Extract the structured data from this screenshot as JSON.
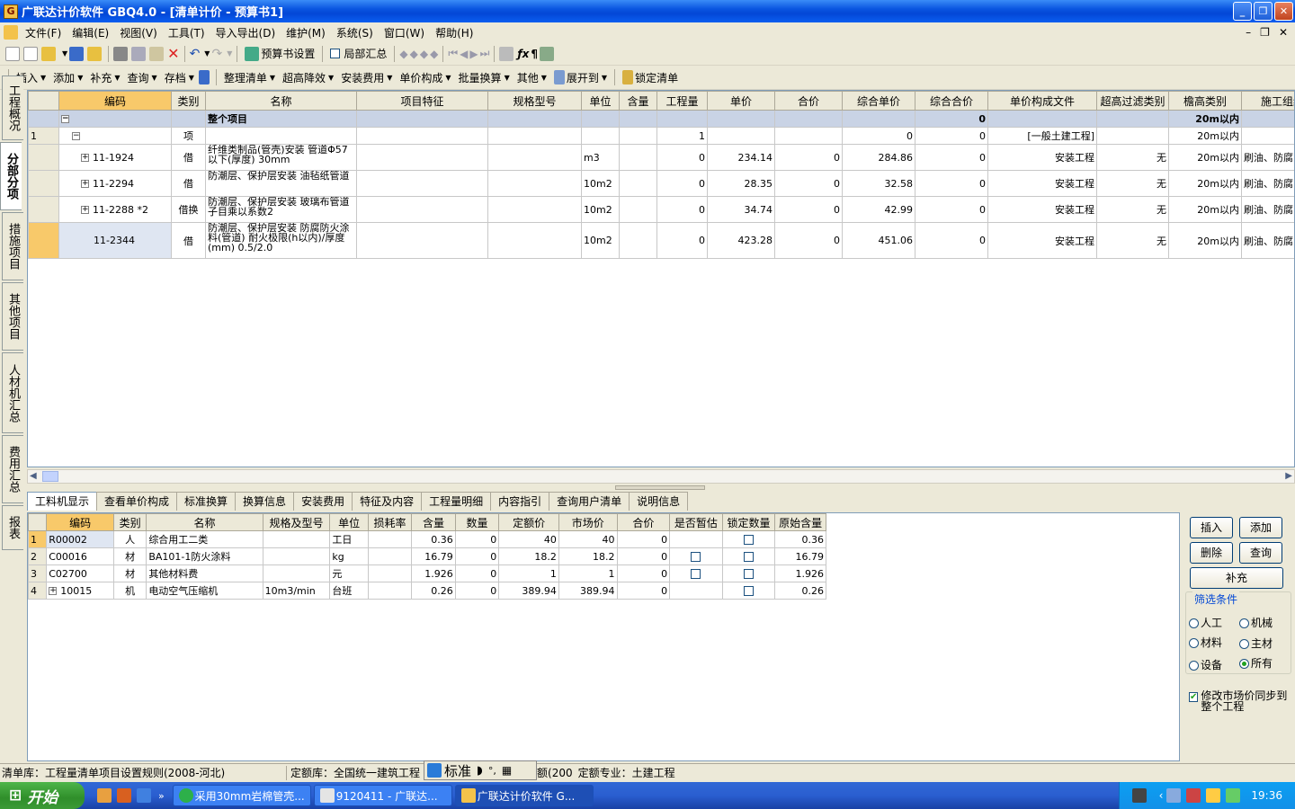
{
  "title": "广联达计价软件 GBQ4.0 - [清单计价 - 预算书1]",
  "menu": [
    "文件(F)",
    "编辑(E)",
    "视图(V)",
    "工具(T)",
    "导入导出(D)",
    "维护(M)",
    "系统(S)",
    "窗口(W)",
    "帮助(H)"
  ],
  "toolbar1": {
    "budget_settings": "预算书设置",
    "partial_summary": "局部汇总"
  },
  "toolbar2": [
    "插入",
    "添加",
    "补充",
    "查询",
    "存档",
    "整理清单",
    "超高降效",
    "安装费用",
    "单价构成",
    "批量换算",
    "其他",
    "展开到",
    "锁定清单"
  ],
  "sidetabs": [
    "工程概况",
    "分部分项",
    "措施项目",
    "其他项目",
    "人材机汇总",
    "费用汇总",
    "报表"
  ],
  "top_headers": [
    "编码",
    "类别",
    "名称",
    "项目特征",
    "规格型号",
    "单位",
    "含量",
    "工程量",
    "单价",
    "合价",
    "综合单价",
    "综合合价",
    "单价构成文件",
    "超高过滤类别",
    "檐高类别",
    "施工组织"
  ],
  "group_row": {
    "name": "整个项目",
    "total": "0",
    "height": "20m以内"
  },
  "top_rows": [
    {
      "rn": "1",
      "code": "",
      "cat": "项",
      "name": "",
      "unit": "",
      "qty": "1",
      "price": "",
      "total": "",
      "comp_price": "0",
      "comp_total": "0",
      "file": "[一般土建工程]",
      "filter": "",
      "height": "20m以内",
      "org": ""
    },
    {
      "rn": "",
      "code": "11-1924",
      "cat": "借",
      "name": "纤维类制品(管壳)安装 管道Φ57以下(厚度) 30mm",
      "unit": "m3",
      "qty": "0",
      "price": "234.14",
      "total": "0",
      "comp_price": "284.86",
      "comp_total": "0",
      "file": "安装工程",
      "filter": "无",
      "height": "20m以内",
      "org": "刷油、防腐"
    },
    {
      "rn": "",
      "code": "11-2294",
      "cat": "借",
      "name": "防潮层、保护层安装 油毡纸管道",
      "unit": "10m2",
      "qty": "0",
      "price": "28.35",
      "total": "0",
      "comp_price": "32.58",
      "comp_total": "0",
      "file": "安装工程",
      "filter": "无",
      "height": "20m以内",
      "org": "刷油、防腐"
    },
    {
      "rn": "",
      "code": "11-2288 *2",
      "cat": "借换",
      "name": "防潮层、保护层安装 玻璃布管道 子目乘以系数2",
      "unit": "10m2",
      "qty": "0",
      "price": "34.74",
      "total": "0",
      "comp_price": "42.99",
      "comp_total": "0",
      "file": "安装工程",
      "filter": "无",
      "height": "20m以内",
      "org": "刷油、防腐"
    },
    {
      "rn": "",
      "code": "11-2344",
      "cat": "借",
      "name": "防潮层、保护层安装 防腐防火涂料(管道) 耐火极限(h以内)/厚度(mm) 0.5/2.0",
      "unit": "10m2",
      "qty": "0",
      "price": "423.28",
      "total": "0",
      "comp_price": "451.06",
      "comp_total": "0",
      "file": "安装工程",
      "filter": "无",
      "height": "20m以内",
      "org": "刷油、防腐"
    }
  ],
  "bottom_tabs": [
    "工料机显示",
    "查看单价构成",
    "标准换算",
    "换算信息",
    "安装费用",
    "特征及内容",
    "工程量明细",
    "内容指引",
    "查询用户清单",
    "说明信息"
  ],
  "bot_headers": [
    "编码",
    "类别",
    "名称",
    "规格及型号",
    "单位",
    "损耗率",
    "含量",
    "数量",
    "定额价",
    "市场价",
    "合价",
    "是否暂估",
    "锁定数量",
    "原始含量"
  ],
  "bot_rows": [
    {
      "rn": "1",
      "code": "R00002",
      "cat": "人",
      "name": "综合用工二类",
      "spec": "",
      "unit": "工日",
      "loss": "",
      "content": "0.36",
      "qty": "0",
      "quota": "40",
      "market": "40",
      "total": "0",
      "est": false,
      "lock": true,
      "orig": "0.36"
    },
    {
      "rn": "2",
      "code": "C00016",
      "cat": "材",
      "name": "BA101-1防火涂料",
      "spec": "",
      "unit": "kg",
      "loss": "",
      "content": "16.79",
      "qty": "0",
      "quota": "18.2",
      "market": "18.2",
      "total": "0",
      "est": true,
      "lock": true,
      "orig": "16.79"
    },
    {
      "rn": "3",
      "code": "C02700",
      "cat": "材",
      "name": "其他材料费",
      "spec": "",
      "unit": "元",
      "loss": "",
      "content": "1.926",
      "qty": "0",
      "quota": "1",
      "market": "1",
      "total": "0",
      "est": true,
      "lock": true,
      "orig": "1.926"
    },
    {
      "rn": "4",
      "code": "10015",
      "cat": "机",
      "name": "电动空气压缩机",
      "spec": "10m3/min",
      "unit": "台班",
      "loss": "",
      "content": "0.26",
      "qty": "0",
      "quota": "389.94",
      "market": "389.94",
      "total": "0",
      "est": false,
      "lock": true,
      "orig": "0.26"
    }
  ],
  "right_panel": {
    "insert": "插入",
    "add": "添加",
    "delete": "删除",
    "query": "查询",
    "supplement": "补充",
    "filter_label": "筛选条件",
    "labor": "人工",
    "machine": "机械",
    "material": "材料",
    "main_material": "主材",
    "equipment": "设备",
    "all": "所有",
    "sync_label": "修改市场价同步到整个工程"
  },
  "status": {
    "list_lib": "清单库：工程量清单项目设置规则(2008-河北)",
    "quota_lib": "定额库：全国统一建筑工程",
    "quota_tail": "额(200",
    "quota_major": "定额专业：土建工程"
  },
  "ime": {
    "mode": "标准"
  },
  "taskbar": {
    "start": "开始",
    "tasks": [
      "采用30mm岩棉管壳...",
      "9120411 - 广联达...",
      "广联达计价软件 G..."
    ],
    "time": "19:36"
  },
  "colors": {
    "title_blue": "#0a55e0",
    "header_selected": "#f8c96a",
    "group_row": "#c9d3e5"
  }
}
